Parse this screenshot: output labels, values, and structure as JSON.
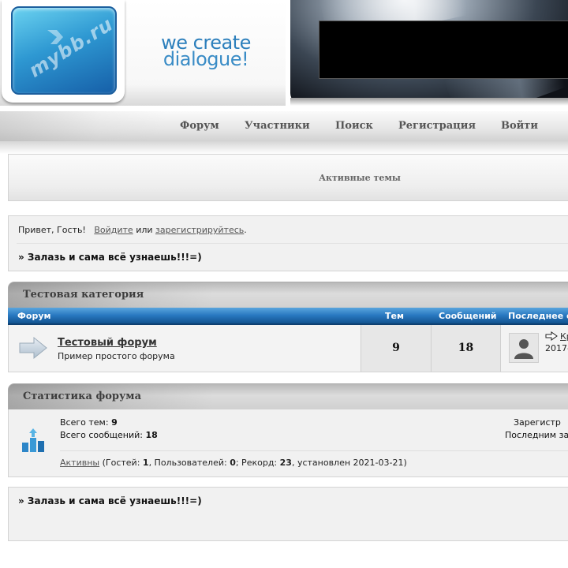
{
  "header": {
    "logo_text": "mybb.ru",
    "tagline_line1": "we create",
    "tagline_line2": "dialogue!"
  },
  "nav": {
    "items": [
      "Форум",
      "Участники",
      "Поиск",
      "Регистрация",
      "Войти"
    ]
  },
  "active_topics": {
    "label": "Активные темы"
  },
  "welcome": {
    "greeting": "Привет, Гость!",
    "login_link": "Войдите",
    "or_text": "или",
    "register_link": "зарегистрируйтесь",
    "period": ".",
    "announcement": "» Залазь и сама всё узнаешь!!!=)"
  },
  "category": {
    "title": "Тестовая категория",
    "columns": {
      "forum": "Форум",
      "topics": "Тем",
      "posts": "Сообщений",
      "last_post": "Последнее с"
    },
    "forum": {
      "name": "Тестовый форум",
      "description": "Пример простого форума",
      "topics": "9",
      "posts": "18",
      "last_author": "Кр",
      "last_date": "2017-"
    }
  },
  "stats": {
    "title": "Статистика форума",
    "total_topics_label": "Всего тем:",
    "total_topics_value": "9",
    "total_posts_label": "Всего сообщений:",
    "total_posts_value": "18",
    "registered_label": "Зарегистр",
    "last_registered_label": "Последним за",
    "online_link": "Активны",
    "online_guests_label": "(Гостей:",
    "online_guests_value": "1",
    "online_users_label": ", Пользователей:",
    "online_users_value": "0",
    "online_record_label": "; Рекорд:",
    "online_record_value": "23",
    "online_record_date": ", установлен 2021-03-21)"
  },
  "footer_announcement": "» Залазь и сама всё узнаешь!!!=)",
  "colors": {
    "table_header_blue": "#2777bf",
    "logo_blue": "#2e98d2",
    "tagline_blue": "#2c7fbc"
  }
}
